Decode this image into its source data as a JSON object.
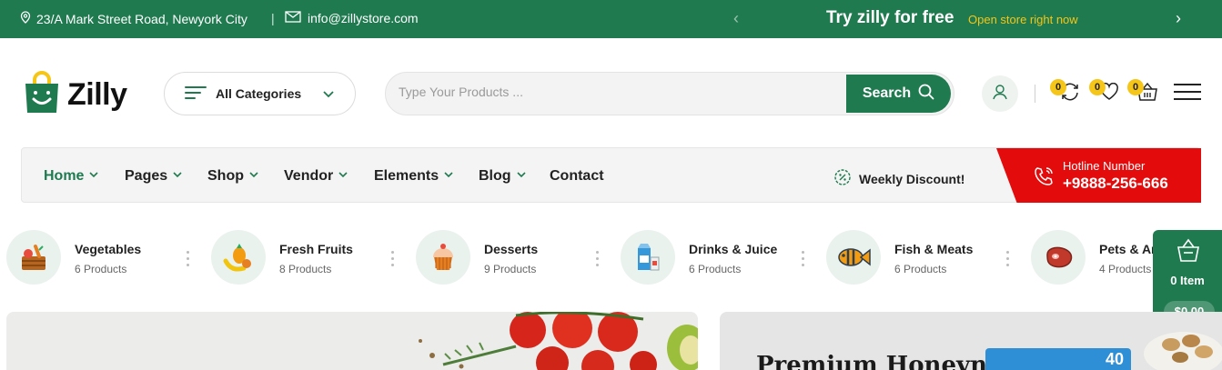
{
  "topbar": {
    "address": "23/A Mark Street Road, Newyork City",
    "separator": "|",
    "email": "info@zillystore.com",
    "promo_title": "Try zilly for free",
    "promo_sub": "Open store right now"
  },
  "header": {
    "logo_text": "Zilly",
    "categories_label": "All Categories",
    "search_placeholder": "Type Your Products ...",
    "search_button": "Search",
    "compare_count": "0",
    "wishlist_count": "0",
    "cart_count": "0"
  },
  "nav": {
    "items": [
      {
        "label": "Home",
        "dropdown": true
      },
      {
        "label": "Pages",
        "dropdown": true
      },
      {
        "label": "Shop",
        "dropdown": true
      },
      {
        "label": "Vendor",
        "dropdown": true
      },
      {
        "label": "Elements",
        "dropdown": true
      },
      {
        "label": "Blog",
        "dropdown": true
      },
      {
        "label": "Contact",
        "dropdown": false
      }
    ],
    "discount_label": "Weekly Discount!",
    "hotline_label": "Hotline Number",
    "hotline_number": "+9888-256-666"
  },
  "categories": [
    {
      "name": "Vegetables",
      "count": "6 Products",
      "icon": "vegetables-icon"
    },
    {
      "name": "Fresh Fruits",
      "count": "8 Products",
      "icon": "fruits-icon"
    },
    {
      "name": "Desserts",
      "count": "9 Products",
      "icon": "dessert-icon"
    },
    {
      "name": "Drinks & Juice",
      "count": "6 Products",
      "icon": "drinks-icon"
    },
    {
      "name": "Fish & Meats",
      "count": "6 Products",
      "icon": "fish-icon"
    },
    {
      "name": "Pets & Animals",
      "count": "4 Products",
      "icon": "meat-icon"
    }
  ],
  "floating_cart": {
    "items": "0 Item",
    "total": "$0.00"
  },
  "banners": {
    "right_title": "Premium Honeynuts",
    "right_pack_badge": "40"
  },
  "colors": {
    "brand_green": "#1f7a4f",
    "accent_yellow": "#f5c518",
    "hotline_red": "#e30b0b"
  }
}
